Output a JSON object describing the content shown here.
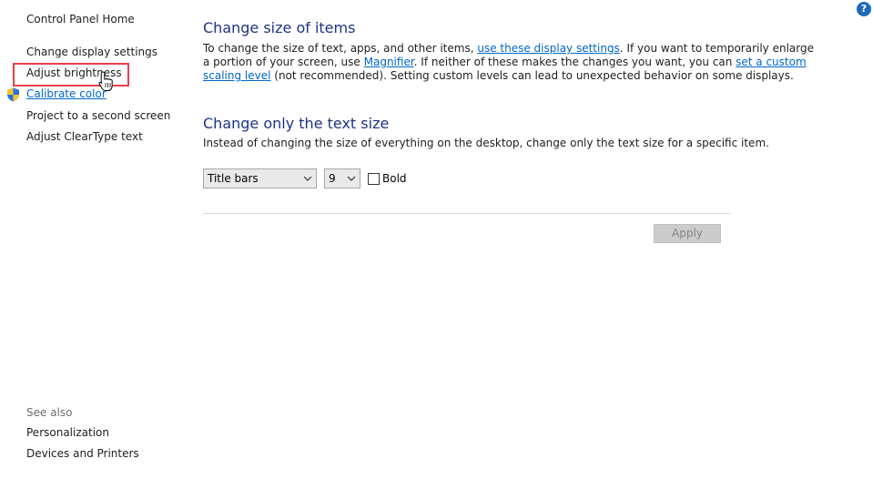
{
  "sidebar": {
    "home": "Control Panel Home",
    "items": [
      {
        "label": "Change display settings"
      },
      {
        "label": "Adjust brightness"
      },
      {
        "label": "Calibrate color"
      },
      {
        "label": "Project to a second screen"
      },
      {
        "label": "Adjust ClearType text"
      }
    ],
    "see_also_label": "See also",
    "see_also": [
      {
        "label": "Personalization"
      },
      {
        "label": "Devices and Printers"
      }
    ]
  },
  "main": {
    "section1": {
      "title": "Change size of items",
      "line1_pre": "To change the size of text, apps, and other items, ",
      "link_display_settings": "use these display settings",
      "line1_post": ".  If you want to temporarily enlarge",
      "line2_pre": "a portion of your screen, use ",
      "link_magnifier": "Magnifier",
      "line2_mid": ".  If neither of these makes the changes you want, you can ",
      "link_custom_1": "set a custom",
      "link_custom_2": "scaling level",
      "line3_post": " (not recommended).  Setting custom levels can lead to unexpected behavior on some displays."
    },
    "section2": {
      "title": "Change only the text size",
      "description": "Instead of changing the size of everything on the desktop, change only the text size for a specific item.",
      "item_select": "Title bars",
      "size_select": "9",
      "bold_label": "Bold",
      "bold_checked": false
    },
    "apply_label": "Apply"
  },
  "help_glyph": "?",
  "colors": {
    "heading": "#1e3287",
    "link": "#0066cc",
    "highlight": "#e8404a"
  }
}
